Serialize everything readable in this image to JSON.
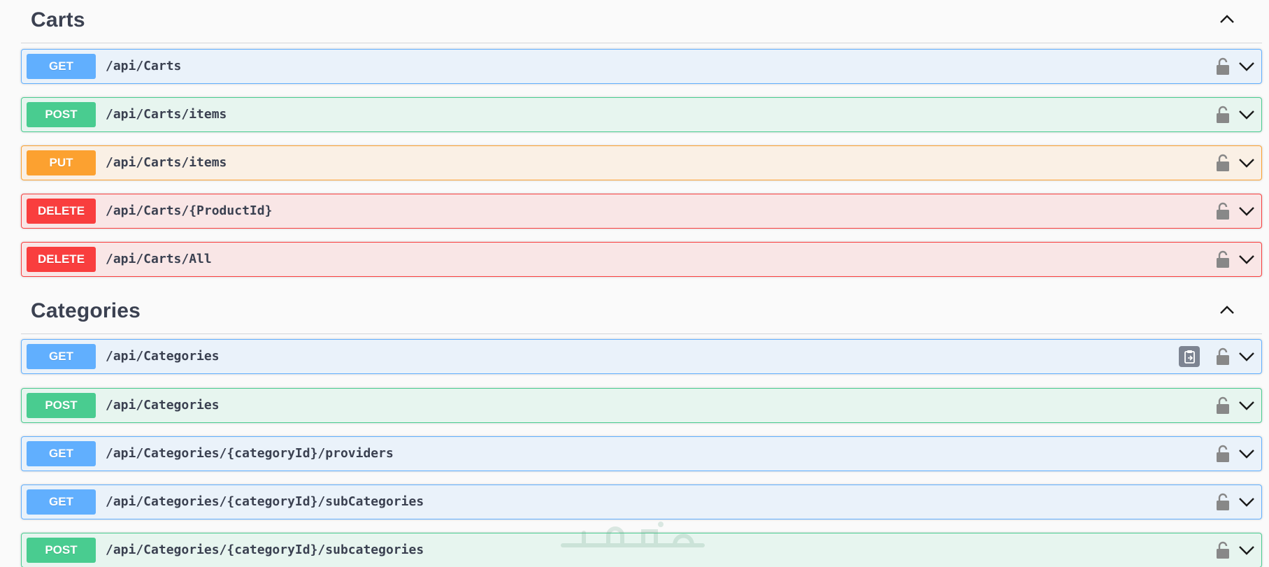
{
  "sections": [
    {
      "title": "Carts",
      "chevron_icon": "chevron-up-icon",
      "operations": [
        {
          "method": "GET",
          "path": "/api/Carts"
        },
        {
          "method": "POST",
          "path": "/api/Carts/items"
        },
        {
          "method": "PUT",
          "path": "/api/Carts/items"
        },
        {
          "method": "DELETE",
          "path": "/api/Carts/{ProductId}"
        },
        {
          "method": "DELETE",
          "path": "/api/Carts/All"
        }
      ]
    },
    {
      "title": "Categories",
      "chevron_icon": "chevron-up-icon",
      "operations": [
        {
          "method": "GET",
          "path": "/api/Categories"
        },
        {
          "method": "POST",
          "path": "/api/Categories"
        },
        {
          "method": "GET",
          "path": "/api/Categories/{categoryId}/providers"
        },
        {
          "method": "GET",
          "path": "/api/Categories/{categoryId}/subCategories"
        },
        {
          "method": "POST",
          "path": "/api/Categories/{categoryId}/subcategories"
        }
      ]
    }
  ],
  "icons": {
    "lock": "lock-open-icon",
    "expand": "chevron-down-icon",
    "copy": "clipboard-copy-icon",
    "watermark": "watermark-logo"
  },
  "colors": {
    "get": "#61affe",
    "post": "#49cc90",
    "put": "#fca130",
    "delete": "#f93e3e",
    "text": "#3b4151",
    "background": "#fafafa"
  },
  "copy_button_on": "/api/Categories",
  "watermark_text": "خمسات"
}
